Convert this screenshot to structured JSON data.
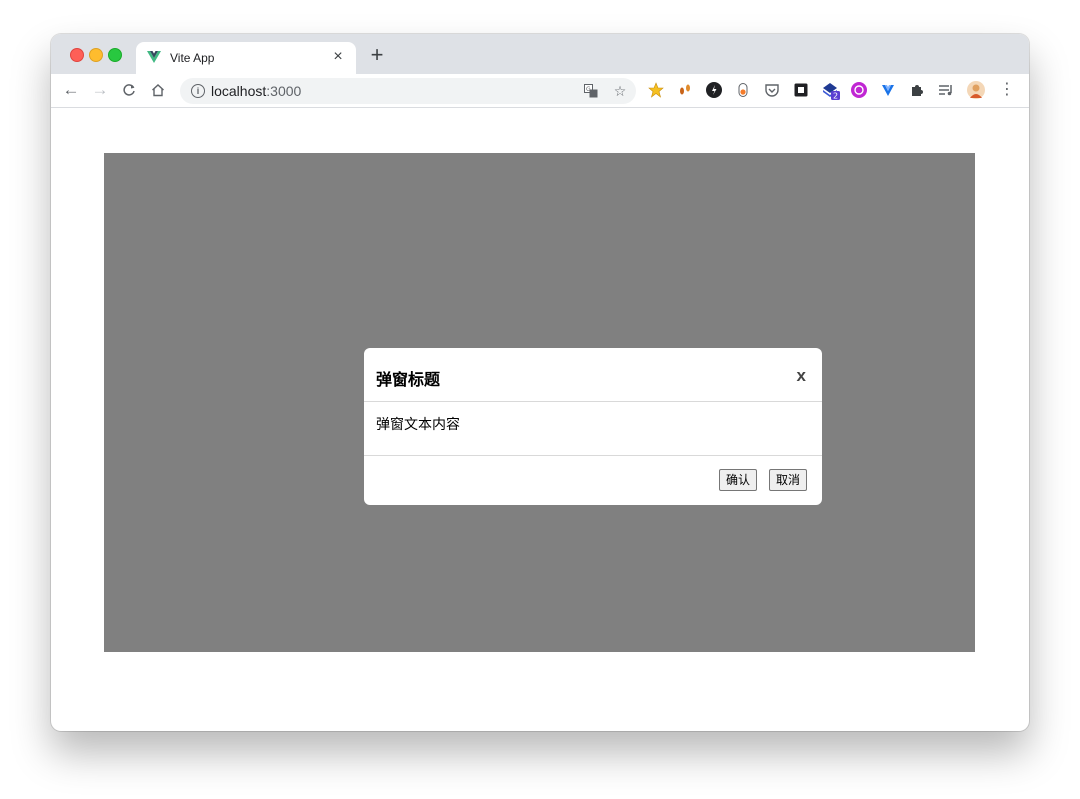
{
  "browser": {
    "tab": {
      "title": "Vite App",
      "close_glyph": "×",
      "favicon": "vue-logo-icon",
      "favicon_color": "#41b883"
    },
    "new_tab_glyph": "+",
    "toolbar": {
      "back": "←",
      "forward": "→",
      "reload": "C",
      "home": "⌂",
      "url_host": "localhost",
      "url_port": ":3000",
      "translate_icon": "translate-icon",
      "bookmark_glyph": "☆",
      "menu_glyph": "⋮",
      "extension_badge": "2"
    },
    "colors": {
      "tabstrip": "#dee1e6",
      "omnibox": "#f1f3f4",
      "overlay": "#808080"
    }
  },
  "modal": {
    "title": "弹窗标题",
    "close_label": "x",
    "body": "弹窗文本内容",
    "confirm_label": "确认",
    "cancel_label": "取消"
  }
}
